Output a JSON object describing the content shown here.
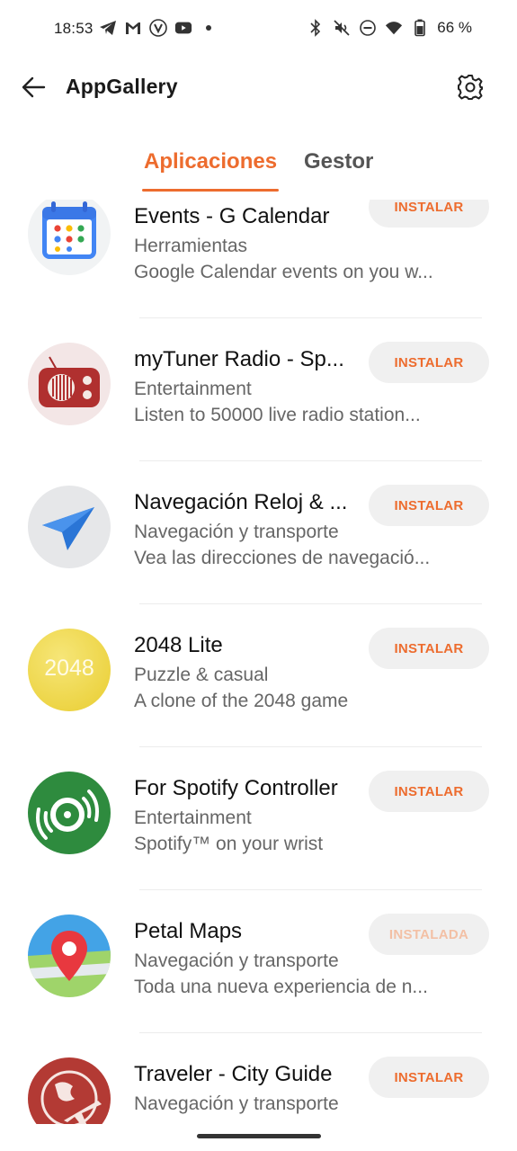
{
  "status_bar": {
    "time": "18:53",
    "battery": "66 %",
    "left_icons": [
      "telegram-icon",
      "gmail-icon",
      "vivaldi-icon",
      "youtube-icon",
      "dot-icon"
    ],
    "right_icons": [
      "bluetooth-icon",
      "mute-icon",
      "dnd-icon",
      "wifi-icon",
      "battery-icon"
    ]
  },
  "header": {
    "title": "AppGallery",
    "back_icon": "arrow-left-icon",
    "settings_icon": "gear-icon"
  },
  "tabs": [
    {
      "label": "Aplicaciones",
      "active": true
    },
    {
      "label": "Gestor",
      "active": false
    }
  ],
  "apps": [
    {
      "name": "Events - G Calendar",
      "category": "Herramientas",
      "description": "Google Calendar events on you w...",
      "button": "INSTALAR",
      "installed": false,
      "icon": "calendar-icon"
    },
    {
      "name": "myTuner Radio - Sp...",
      "category": "Entertainment",
      "description": "Listen to 50000 live radio station...",
      "button": "INSTALAR",
      "installed": false,
      "icon": "radio-icon"
    },
    {
      "name": "Navegación Reloj & ...",
      "category": "Navegación y transporte",
      "description": "Vea las direcciones de navegació...",
      "button": "INSTALAR",
      "installed": false,
      "icon": "navigation-arrow-icon"
    },
    {
      "name": "2048 Lite",
      "category": "Puzzle & casual",
      "description": "A clone of the 2048 game",
      "button": "INSTALAR",
      "installed": false,
      "icon": "game-2048-icon",
      "icon_text": "2048"
    },
    {
      "name": "For Spotify Controller",
      "category": "Entertainment",
      "description": "Spotify™ on your wrist",
      "button": "INSTALAR",
      "installed": false,
      "icon": "spotify-disc-icon"
    },
    {
      "name": "Petal Maps",
      "category": "Navegación y transporte",
      "description": "Toda una nueva experiencia de n...",
      "button": "INSTALADA",
      "installed": true,
      "icon": "map-pin-icon"
    },
    {
      "name": "Traveler - City Guide",
      "category": "Navegación y transporte",
      "description": "",
      "button": "INSTALAR",
      "installed": false,
      "icon": "globe-plane-icon"
    }
  ],
  "colors": {
    "accent": "#ed6c2e",
    "installed_text": "#f3c0a5",
    "button_bg": "#f0f0f0"
  }
}
